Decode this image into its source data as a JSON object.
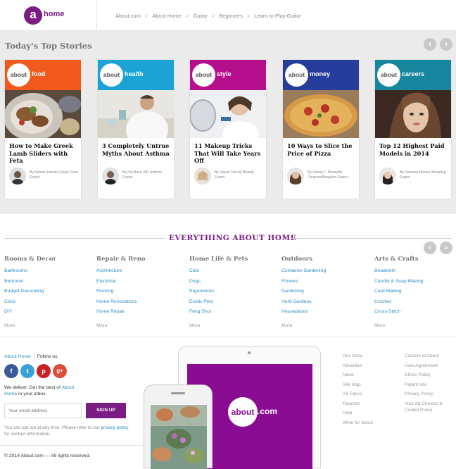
{
  "header": {
    "logo_letter": "a",
    "logo_text": "home",
    "breadcrumb": [
      "About.com",
      "About Home",
      "Guitar",
      "Beginners",
      "Learn to Play Guitar"
    ],
    "separator": ">"
  },
  "top_stories": {
    "title": "Today's Top Stories",
    "prev_label": "‹",
    "next_label": "›",
    "cards": [
      {
        "badge": "about",
        "category": "food",
        "color": "#f25a1d",
        "title": "How to Make Greek Lamb Sliders with Feta",
        "by": "By Kenton Kotsiris Greek Food Expert"
      },
      {
        "badge": "about",
        "category": "health",
        "color": "#1aa3d4",
        "title": "3 Completely Untrue Myths About Asthma",
        "by": "By Pat Bass, MD Asthma Expert"
      },
      {
        "badge": "about",
        "category": "style",
        "color": "#b50f8e",
        "title": "11 Makeup Tricks That Will Take Years Off",
        "by": "By Julyne Derrick Beauty Expert"
      },
      {
        "badge": "about",
        "category": "money",
        "color": "#263d9b",
        "title": "10 Ways to Slice the Price of Pizza",
        "by": "By Donna L. Montaldo Coupons/Bargains Expert"
      },
      {
        "badge": "about",
        "category": "careers",
        "color": "#17869f",
        "title": "Top 12 Highest Paid Models in 2014",
        "by": "By Vanessa Helmer Modeling Expert"
      }
    ]
  },
  "everything": {
    "title": "EVERYTHING ABOUT HOME",
    "prev_label": "‹",
    "next_label": "›",
    "more_label": "More",
    "columns": [
      {
        "heading": "Rooms & Decor",
        "links": [
          "Bathrooms",
          "Bedroom",
          "Budget Decorating",
          "Color",
          "DIY"
        ]
      },
      {
        "heading": "Repair & Reno",
        "links": [
          "Architecture",
          "Electrical",
          "Flooring",
          "Home Renovations",
          "Home Repair"
        ]
      },
      {
        "heading": "Home Life & Pets",
        "links": [
          "Cats",
          "Dogs",
          "Ergonomics",
          "Exotic Pets",
          "Feng Shui"
        ]
      },
      {
        "heading": "Outdoors",
        "links": [
          "Container Gardening",
          "Flowers",
          "Gardening",
          "Herb Gardens",
          "Houseplants"
        ]
      },
      {
        "heading": "Arts & Crafts",
        "links": [
          "Beadwork",
          "Candle & Soap Making",
          "Card Making",
          "Crochet",
          "Cross-Stitch"
        ]
      }
    ]
  },
  "footer": {
    "about_home": "About Home",
    "follow_us": "Follow us:",
    "social": [
      {
        "name": "facebook",
        "glyph": "f",
        "color": "#3b5998"
      },
      {
        "name": "twitter",
        "glyph": "t",
        "color": "#3aa0d8"
      },
      {
        "name": "pinterest",
        "glyph": "p",
        "color": "#cb2027"
      },
      {
        "name": "google-plus",
        "glyph": "g+",
        "color": "#dd4b39"
      }
    ],
    "deliver_text": "We deliver. Get the best of",
    "deliver_link": "About Home",
    "deliver_suffix": "in your inbox.",
    "email_placeholder": "Your email address",
    "signup_label": "SIGN UP",
    "optout_text": "You can opt out at any time. Please refer to our",
    "optout_link": "privacy policy",
    "optout_suffix": "for contact information.",
    "copyright": "© 2014 About.com — All rights reserved.",
    "links_col1": [
      "Our Story",
      "Advertise",
      "News",
      "Site Map",
      "All Topics",
      "Reprints",
      "Help",
      "Write for About"
    ],
    "links_col2": [
      "Careers at About",
      "User Agreement",
      "Ethics Policy",
      "Patent Info",
      "Privacy Policy",
      "Your Ad Choices &",
      "Cookie Policy"
    ],
    "device_badge": "about",
    "device_brand": ".com"
  }
}
